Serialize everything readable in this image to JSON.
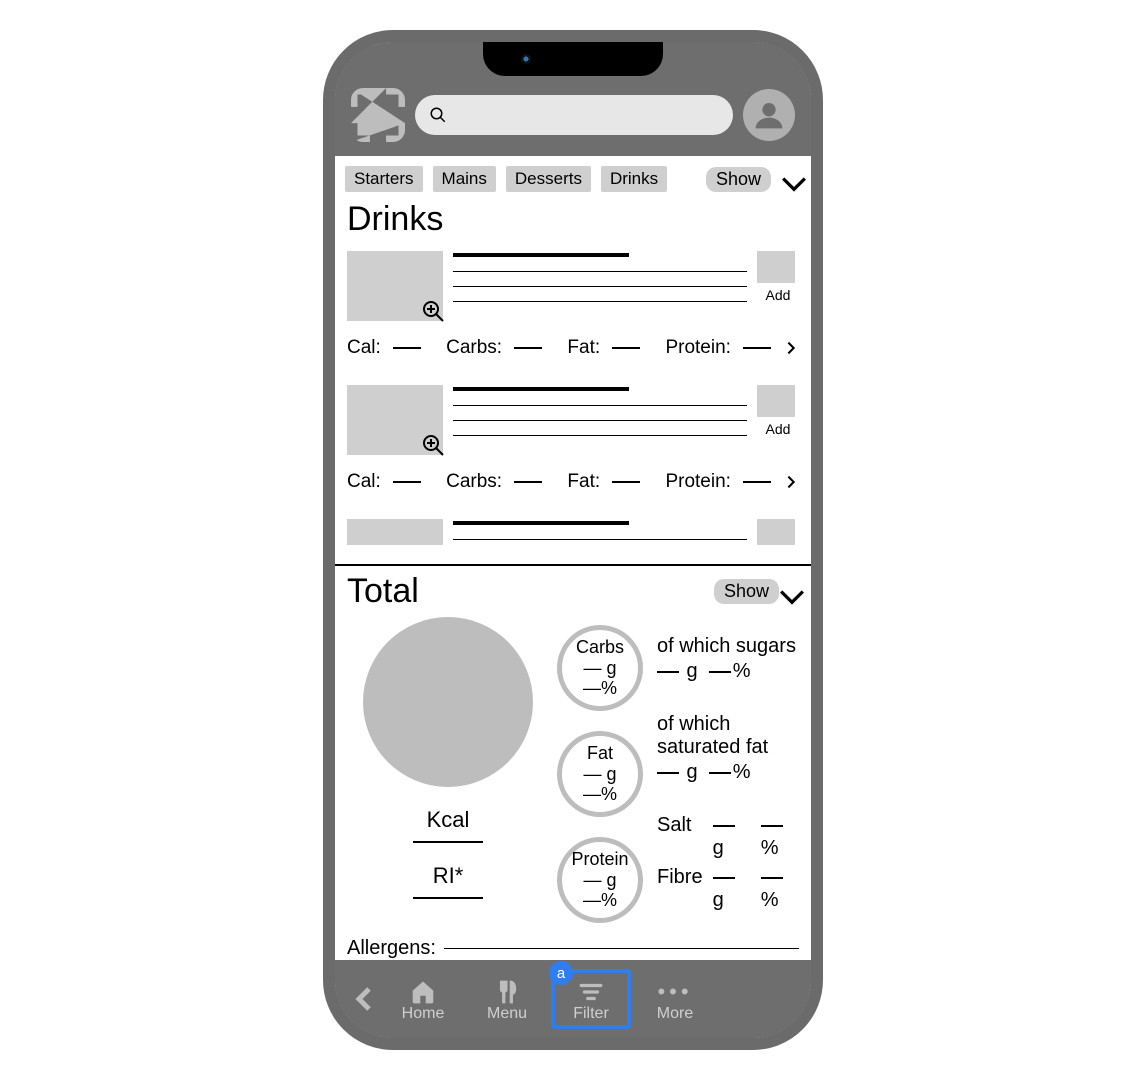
{
  "header": {
    "search_placeholder": ""
  },
  "chips": [
    "Starters",
    "Mains",
    "Desserts",
    "Drinks"
  ],
  "show_label": "Show",
  "section_title": "Drinks",
  "item_add_label": "Add",
  "nutri_labels": {
    "cal": "Cal:",
    "carbs": "Carbs:",
    "fat": "Fat:",
    "protein": "Protein:"
  },
  "total": {
    "title": "Total",
    "kcal_label": "Kcal",
    "ri_label": "RI*",
    "macros": [
      {
        "name": "Carbs",
        "g": "— g",
        "pct": "—%",
        "sub_label": "of which sugars",
        "sub_g": "— g",
        "sub_pct": "—%"
      },
      {
        "name": "Fat",
        "g": "— g",
        "pct": "—%",
        "sub_label": "of which saturated fat",
        "sub_g": "— g",
        "sub_pct": "—%"
      },
      {
        "name": "Protein",
        "g": "— g",
        "pct": "—%"
      }
    ],
    "extras": [
      {
        "name": "Salt",
        "g": "— g",
        "pct": "—%"
      },
      {
        "name": "Fibre",
        "g": "— g",
        "pct": "—%"
      }
    ],
    "allergens_label": "Allergens:"
  },
  "nav": {
    "home": "Home",
    "menu": "Menu",
    "filter": "Filter",
    "more": "More",
    "filter_badge": "a"
  }
}
